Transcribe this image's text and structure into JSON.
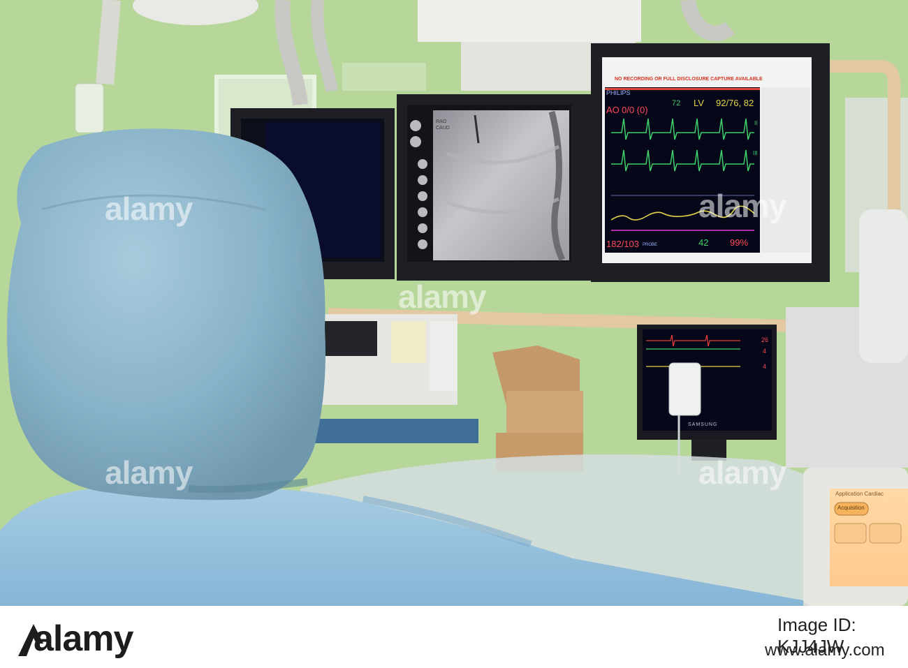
{
  "monitor": {
    "brand": "PHILIPS",
    "banner": "NO RECORDING OR FULL DISCLOSURE CAPTURE AVAILABLE",
    "ao_label": "AO",
    "ao_value": "0/0 (0)",
    "hr_value": "72",
    "lv_label": "LV",
    "lv_value": "92/76, 82",
    "bp_value": "182/103",
    "probe_label": "PROBE",
    "lower_value": "42",
    "spo2_value": "99%",
    "lead_ii": "II",
    "lead_iii": "III"
  },
  "fluoro": {
    "label": "RAO CAUD"
  },
  "cath_monitor": {
    "brand": "SAMSUNG",
    "value_1": "26",
    "value_2": "4",
    "value_3": "4"
  },
  "table_panel": {
    "title": "Application Cardiac",
    "acquisition_button": "Acquisition"
  },
  "watermark": {
    "text": "alamy"
  },
  "footer": {
    "brand": "alamy",
    "image_id": "Image ID: KJJ4JW",
    "url": "www.alamy.com"
  },
  "colors": {
    "wall": "#b5d598",
    "ecg_green": "#3fd16b",
    "pressure_yellow": "#e5d44a",
    "magenta": "#e23bd0",
    "scrub_blue": "#9cc4de",
    "cap_blue": "#8fb6cc"
  }
}
